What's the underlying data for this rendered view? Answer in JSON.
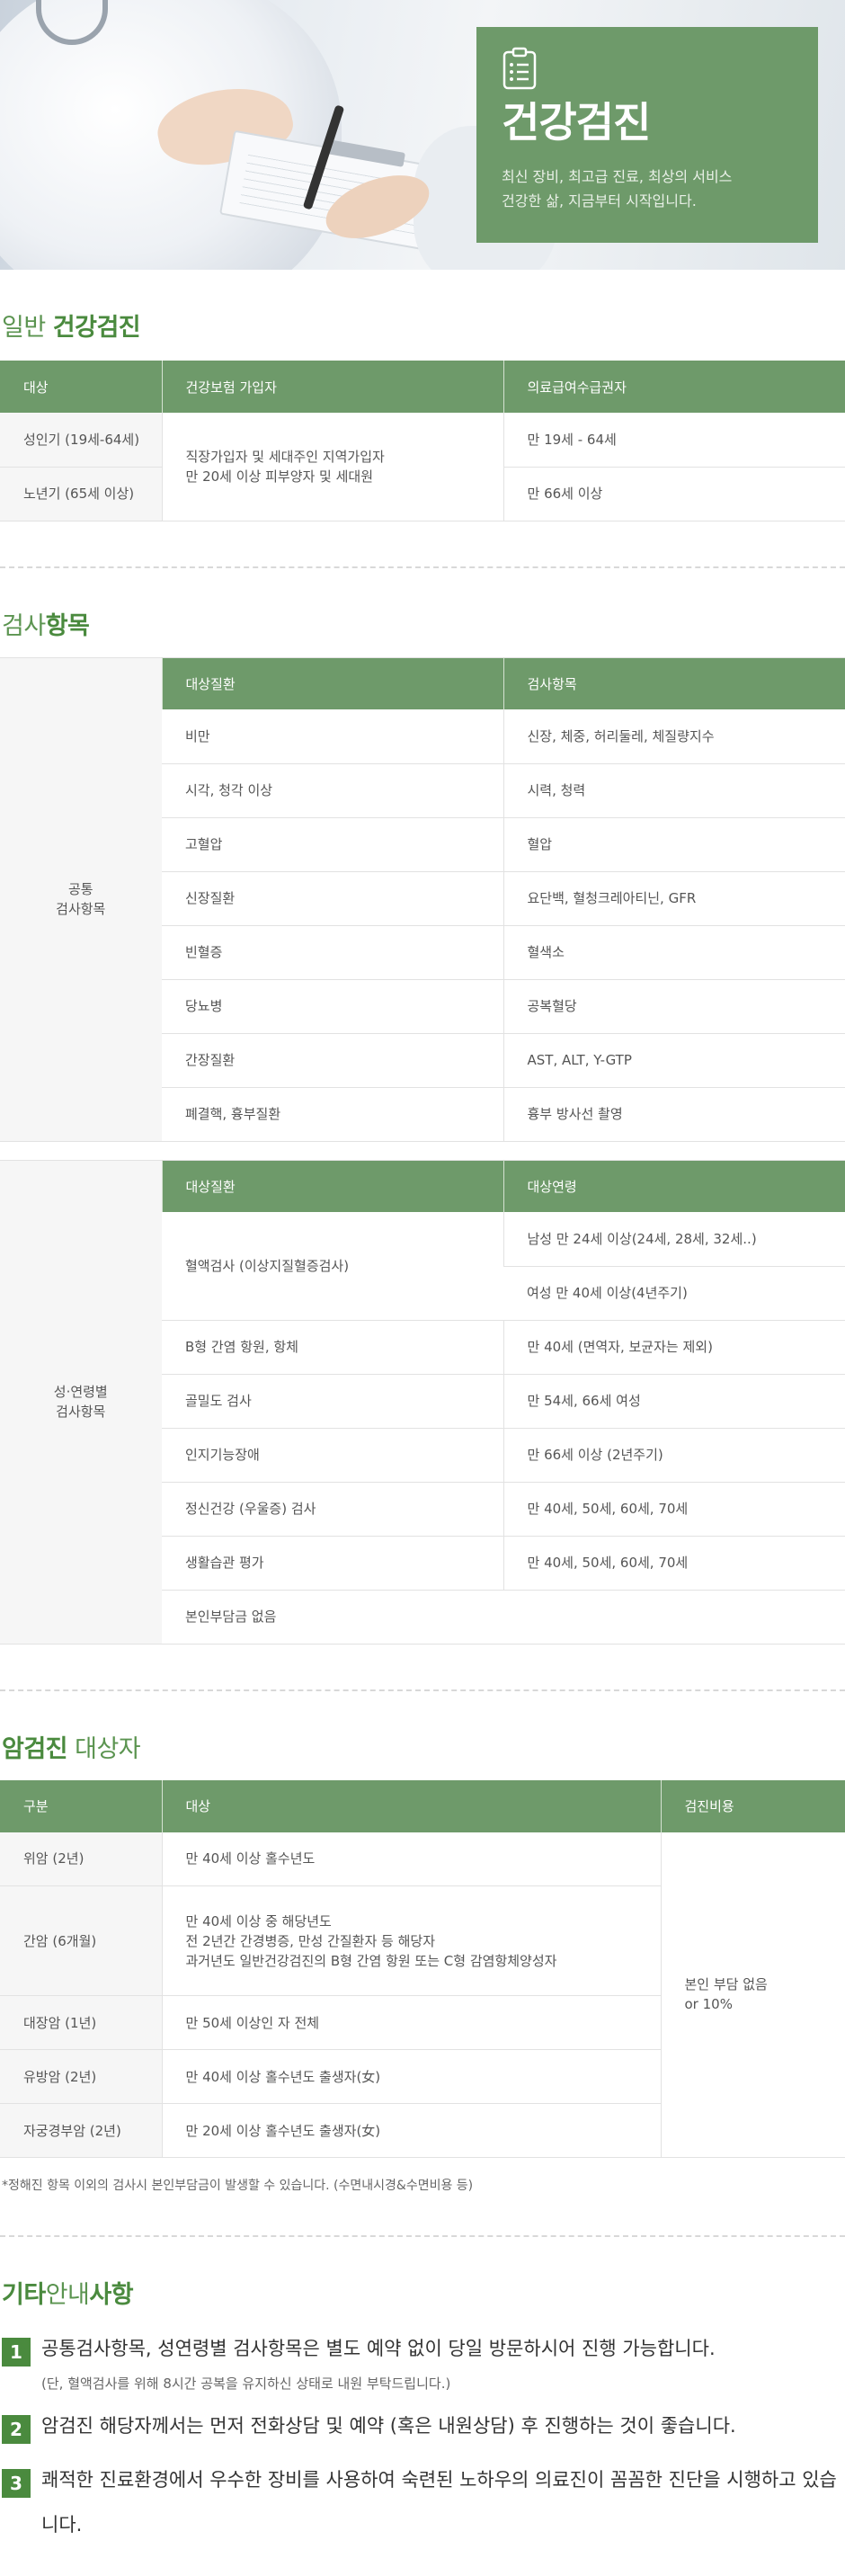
{
  "hero": {
    "title": "건강검진",
    "line1": "최신 장비, 최고급 진료, 최상의 서비스",
    "line2": "건강한 삶, 지금부터 시작입니다."
  },
  "general": {
    "title_light": "일반",
    "title_bold": "건강검진",
    "headers": [
      "대상",
      "건강보험 가입자",
      "의료급여수급권자"
    ],
    "rows": [
      {
        "target": "성인기 (19세-64세)",
        "medicaid": "만 19세 - 64세"
      },
      {
        "target": "노년기 (65세 이상)",
        "medicaid": "만 66세 이상"
      }
    ],
    "insured_line1": "직장가입자 및 세대주인 지역가입자",
    "insured_line2": "만 20세 이상 피부양자 및 세대원"
  },
  "exam": {
    "title_light": "검사",
    "title_bold": "항목",
    "common": {
      "label_line1": "공통",
      "label_line2": "검사항목",
      "headers": [
        "대상질환",
        "검사항목"
      ],
      "rows": [
        {
          "disease": "비만",
          "test": "신장, 체중, 허리둘레, 체질량지수"
        },
        {
          "disease": "시각, 청각 이상",
          "test": "시력, 청력"
        },
        {
          "disease": "고혈압",
          "test": "혈압"
        },
        {
          "disease": "신장질환",
          "test": "요단백, 혈청크레아티닌, GFR"
        },
        {
          "disease": "빈혈증",
          "test": "혈색소"
        },
        {
          "disease": "당뇨병",
          "test": "공복혈당"
        },
        {
          "disease": "간장질환",
          "test": "AST, ALT, Y-GTP"
        },
        {
          "disease": "폐결핵, 흉부질환",
          "test": "흉부 방사선 촬영"
        }
      ]
    },
    "gender_age": {
      "label_line1": "성·연령별",
      "label_line2": "검사항목",
      "headers": [
        "대상질환",
        "대상연령"
      ],
      "blood_test": "혈액검사 (이상지질혈증검사)",
      "blood_male": "남성 만 24세 이상(24세, 28세, 32세..)",
      "blood_female": "여성 만 40세 이상(4년주기)",
      "rows": [
        {
          "disease": "B형 간염 항원, 항체",
          "age": "만 40세 (면역자, 보균자는 제외)"
        },
        {
          "disease": "골밀도 검사",
          "age": "만 54세, 66세 여성"
        },
        {
          "disease": "인지기능장애",
          "age": "만 66세 이상 (2년주기)"
        },
        {
          "disease": "정신건강 (우울증) 검사",
          "age": "만 40세, 50세, 60세, 70세"
        },
        {
          "disease": "생활습관 평가",
          "age": "만 40세, 50세, 60세, 70세"
        }
      ],
      "footer": "본인부담금 없음"
    }
  },
  "cancer": {
    "title_bold": "암검진",
    "title_light": "대상자",
    "headers": [
      "구분",
      "대상",
      "검진비용"
    ],
    "rows": [
      {
        "type": "위암 (2년)",
        "target": [
          "만 40세 이상 홀수년도"
        ]
      },
      {
        "type": "간암 (6개월)",
        "target": [
          "만 40세 이상 중 해당년도",
          "전 2년간 간경병증, 만성 간질환자 등 해당자",
          "과거년도 일반건강검진의 B형 간염 항원 또는 C형 감염항체양성자"
        ]
      },
      {
        "type": "대장암 (1년)",
        "target": [
          "만 50세 이상인 자 전체"
        ]
      },
      {
        "type": "유방암 (2년)",
        "target": [
          "만 40세 이상 홀수년도 출생자(女)"
        ]
      },
      {
        "type": "자궁경부암 (2년)",
        "target": [
          "만 20세 이상 홀수년도 출생자(女)"
        ]
      }
    ],
    "cost_line1": "본인 부담 없음",
    "cost_line2": "or 10%",
    "note": "*정해진 항목 이외의 검사시 본인부담금이 발생할 수 있습니다. (수면내시경&수면비용 등)"
  },
  "etc": {
    "title_bold1": "기타",
    "title_light": "안내",
    "title_bold2": "사항",
    "items": [
      {
        "num": "1",
        "text": "공통검사항목, 성연령별 검사항목은 별도 예약 없이 당일 방문하시어 진행 가능합니다.",
        "sub": "(단, 혈액검사를 위해 8시간 공복을 유지하신 상태로 내원 부탁드립니다.)"
      },
      {
        "num": "2",
        "text": "암검진 해당자께서는 먼저 전화상담 및 예약 (혹은 내원상담) 후 진행하는 것이 좋습니다."
      },
      {
        "num": "3",
        "text": "쾌적한 진료환경에서 우수한 장비를 사용하여 숙련된 노하우의 의료진이 꼼꼼한 진단을 시행하고 있습니다."
      }
    ]
  },
  "colors": {
    "accent": "#6e9a6a",
    "accent_dark": "#4a8a3e",
    "title_light": "#5b9450"
  }
}
